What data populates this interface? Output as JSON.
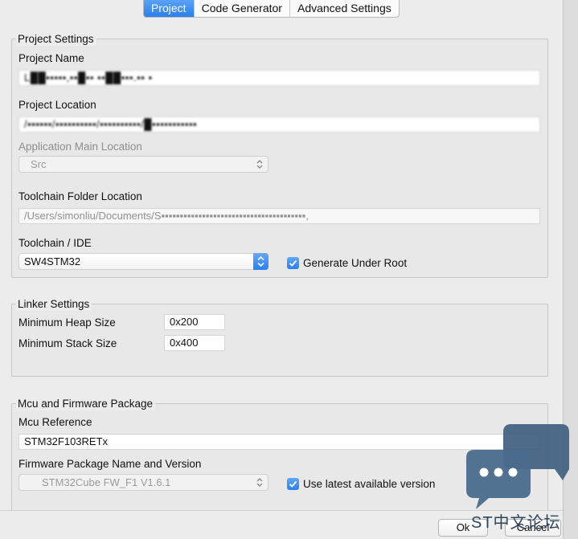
{
  "tabs": [
    {
      "label": "Project",
      "active": true
    },
    {
      "label": "Code Generator",
      "active": false
    },
    {
      "label": "Advanced Settings",
      "active": false
    }
  ],
  "project_settings": {
    "legend": "Project Settings",
    "name_label": "Project Name",
    "name_value": "L██▪▪▪▪▪,▪▪█▪▪     ▪▪██▪▪▪.▪▪  ▪",
    "location_label": "Project Location",
    "location_value": "/▪▪▪▪▪▪/▪▪▪▪▪▪▪▪▪▪/▪▪▪▪▪▪▪▪▪▪/█▪▪▪▪▪▪▪▪▪▪▪",
    "app_main_label": "Application Main Location",
    "app_main_value": "Src",
    "toolchain_folder_label": "Toolchain Folder Location",
    "toolchain_folder_value": "/Users/simonliu/Documents/S▪▪▪▪▪▪▪▪▪▪▪▪▪▪▪▪▪▪▪▪▪▪▪▪▪▪▪▪▪▪▪▪▪▪▪▪▪▪▪,",
    "toolchain_label": "Toolchain / IDE",
    "toolchain_value": "SW4STM32",
    "generate_under_root_label": "Generate Under Root",
    "generate_under_root_checked": true
  },
  "linker_settings": {
    "legend": "Linker Settings",
    "heap_label": "Minimum Heap Size",
    "heap_value": "0x200",
    "stack_label": "Minimum Stack Size",
    "stack_value": "0x400"
  },
  "mcu_firmware": {
    "legend": "Mcu and Firmware Package",
    "mcu_ref_label": "Mcu Reference",
    "mcu_ref_value": "STM32F103RETx",
    "fw_label": "Firmware Package Name and Version",
    "fw_value": "STM32Cube FW_F1 V1.6.1",
    "use_latest_label": "Use latest available version",
    "use_latest_checked": true
  },
  "footer": {
    "ok_label": "Ok",
    "cancel_label": "Cancel"
  },
  "watermark": {
    "text": "ST中文论坛"
  },
  "colors": {
    "accent": "#2c7fee",
    "window_bg": "#ececec",
    "watermark_bubble": "#4a6a8a"
  }
}
